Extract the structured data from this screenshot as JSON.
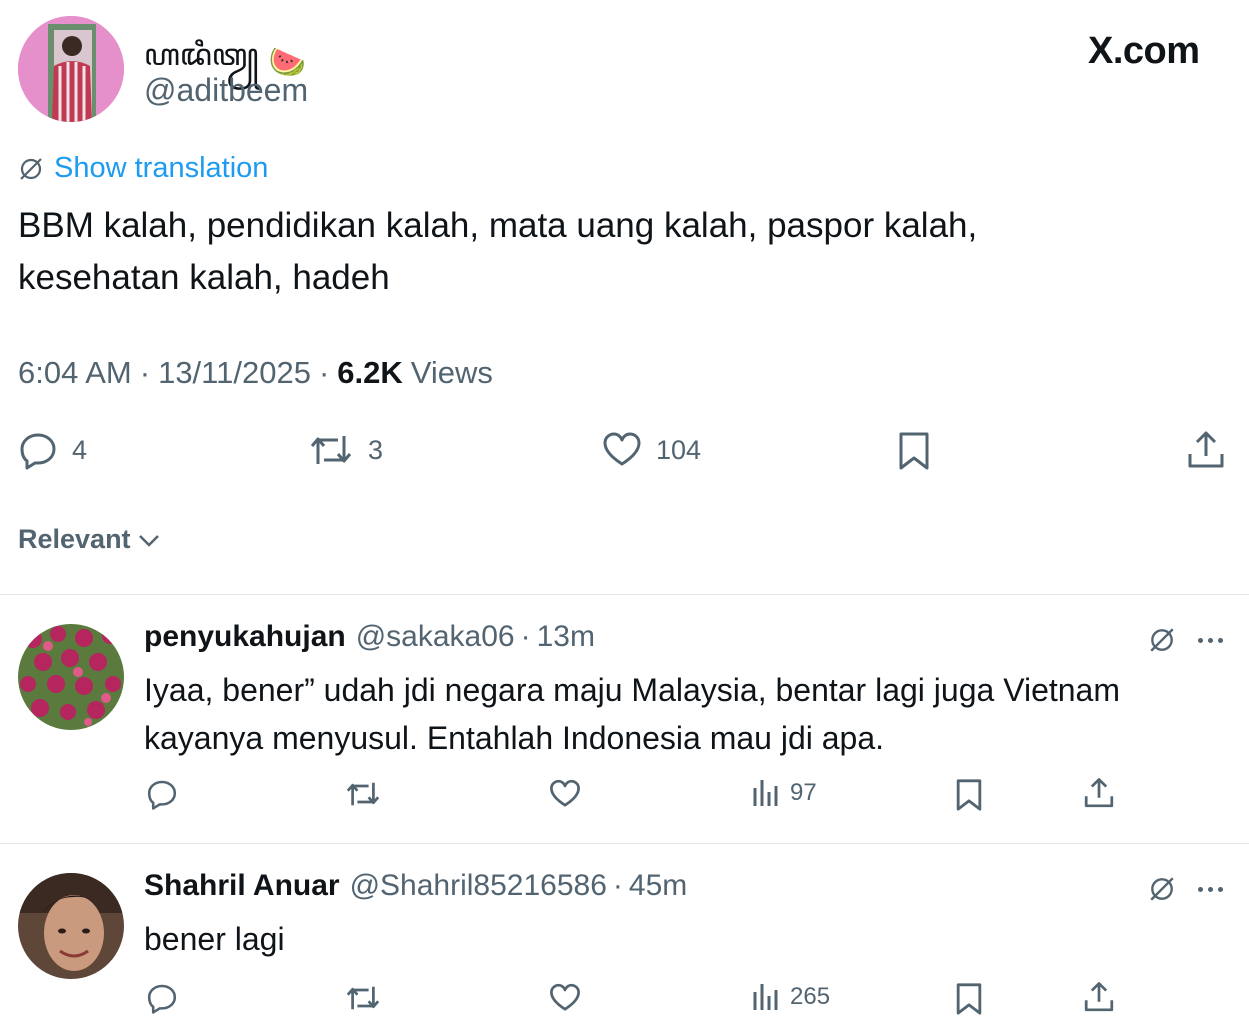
{
  "header": {
    "author_name": "ꦲꦢꦶꦠꦾ",
    "author_emoji": "🍉",
    "author_handle": "@aditbeem",
    "site_watermark": "X.com"
  },
  "tweet": {
    "translate_label": "Show translation",
    "text_line1": "BBM kalah, pendidikan kalah, mata uang kalah, paspor kalah,",
    "text_line2": "kesehatan kalah, hadeh",
    "time": "6:04 AM",
    "date": "13/11/2025",
    "separator": "·",
    "views_count": "6.2K",
    "views_label": "Views",
    "replies": "4",
    "reposts": "3",
    "likes": "104"
  },
  "sort": {
    "label": "Relevant"
  },
  "replies": [
    {
      "name": "penyukahujan",
      "handle": "@sakaka06",
      "time": "13m",
      "text_line1": "Iyaa, bener” udah jdi negara maju Malaysia, bentar lagi juga Vietnam",
      "text_line2": "kayanya menyusul. Entahlah Indonesia mau jdi apa.",
      "views": "97"
    },
    {
      "name": "Shahril Anuar",
      "handle": "@Shahril85216586",
      "time": "45m",
      "text_line1": "bener lagi",
      "views": "265"
    }
  ],
  "colors": {
    "link": "#1d9bf0",
    "text": "#0f1419",
    "muted": "#536471",
    "divider": "#e1e8ed"
  }
}
